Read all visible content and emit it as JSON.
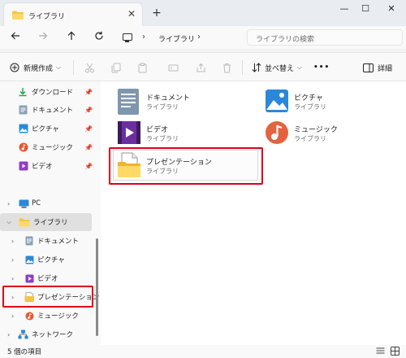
{
  "window": {
    "tab_title": "ライブラリ",
    "tab_close": "✕",
    "new_tab": "+",
    "minimize": "—",
    "maximize": "☐",
    "close": "✕"
  },
  "address": {
    "crumbs": [
      "ライブラリ"
    ],
    "search_placeholder": "ライブラリの検索"
  },
  "commands": {
    "new": "新規作成",
    "sort": "並べ替え",
    "details": "詳細",
    "more": "•••"
  },
  "sidebar": {
    "quick_access": [
      {
        "label": "ダウンロード",
        "icon": "download-icon"
      },
      {
        "label": "ドキュメント",
        "icon": "document-icon"
      },
      {
        "label": "ピクチャ",
        "icon": "picture-icon"
      },
      {
        "label": "ミュージック",
        "icon": "music-icon"
      },
      {
        "label": "ビデオ",
        "icon": "video-icon"
      }
    ],
    "tree": [
      {
        "label": "PC",
        "icon": "pc-icon"
      },
      {
        "label": "ライブラリ",
        "icon": "folder-icon"
      },
      {
        "label": "ドキュメント",
        "icon": "document-icon"
      },
      {
        "label": "ピクチャ",
        "icon": "picture-icon"
      },
      {
        "label": "ビデオ",
        "icon": "video-icon"
      },
      {
        "label": "プレゼンテーション",
        "icon": "presentation-folder-icon"
      },
      {
        "label": "ミュージック",
        "icon": "music-icon"
      },
      {
        "label": "ネットワーク",
        "icon": "network-icon"
      }
    ]
  },
  "libraries": [
    {
      "name": "ドキュメント",
      "type": "ライブラリ",
      "icon": "document-library-icon"
    },
    {
      "name": "ピクチャ",
      "type": "ライブラリ",
      "icon": "picture-library-icon"
    },
    {
      "name": "ビデオ",
      "type": "ライブラリ",
      "icon": "video-library-icon"
    },
    {
      "name": "ミュージック",
      "type": "ライブラリ",
      "icon": "music-library-icon"
    },
    {
      "name": "プレゼンテーション",
      "type": "ライブラリ",
      "icon": "presentation-library-icon"
    }
  ],
  "status": {
    "item_count": "5 個の項目"
  },
  "colors": {
    "highlight": "#e0001a",
    "accent": "#0067c0",
    "folder": "#f6c544"
  }
}
